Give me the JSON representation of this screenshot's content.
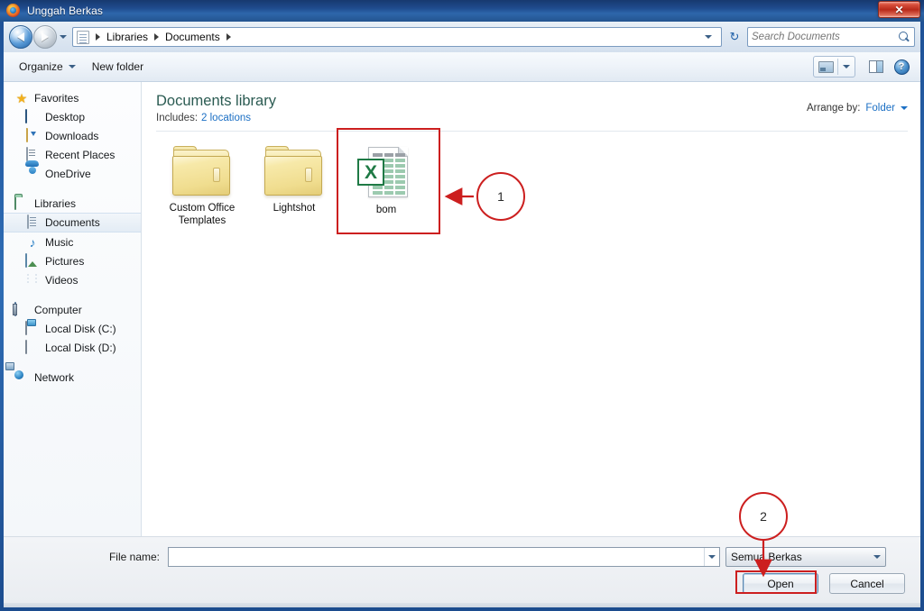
{
  "window": {
    "title": "Unggah Berkas",
    "title_icon": "firefox-icon",
    "close_label": "✕"
  },
  "address_bar": {
    "back_icon": "back-arrow-icon",
    "forward_icon": "forward-arrow-icon",
    "history_icon": "chevron-down-icon",
    "path_icon": "document-icon",
    "breadcrumbs": [
      "Libraries",
      "Documents"
    ],
    "dropdown_icon": "chevron-down-icon",
    "refresh_icon": "refresh-icon",
    "refresh_glyph": "↻"
  },
  "search": {
    "placeholder": "Search Documents",
    "value": "",
    "icon": "search-icon"
  },
  "toolbar": {
    "organize_label": "Organize",
    "organize_caret": "caret-down-icon",
    "new_folder_label": "New folder",
    "view_icon": "view-mode-icon",
    "view_caret": "chevron-down-icon",
    "preview_pane_icon": "preview-pane-icon",
    "help_icon": "help-icon",
    "help_glyph": "?"
  },
  "sidebar": {
    "groups": [
      {
        "header": {
          "label": "Favorites",
          "icon": "star-icon"
        },
        "items": [
          {
            "label": "Desktop",
            "icon": "desktop-icon"
          },
          {
            "label": "Downloads",
            "icon": "downloads-icon"
          },
          {
            "label": "Recent Places",
            "icon": "recent-places-icon"
          },
          {
            "label": "OneDrive",
            "icon": "onedrive-cloud-icon"
          }
        ]
      },
      {
        "header": {
          "label": "Libraries",
          "icon": "libraries-icon"
        },
        "items": [
          {
            "label": "Documents",
            "icon": "documents-icon",
            "selected": true
          },
          {
            "label": "Music",
            "icon": "music-note-icon"
          },
          {
            "label": "Pictures",
            "icon": "pictures-icon"
          },
          {
            "label": "Videos",
            "icon": "videos-icon"
          }
        ]
      },
      {
        "header": {
          "label": "Computer",
          "icon": "computer-icon"
        },
        "items": [
          {
            "label": "Local Disk (C:)",
            "icon": "system-drive-icon"
          },
          {
            "label": "Local Disk (D:)",
            "icon": "drive-icon"
          }
        ]
      },
      {
        "header": {
          "label": "Network",
          "icon": "network-icon"
        },
        "items": []
      }
    ]
  },
  "content": {
    "library_title": "Documents library",
    "includes_label": "Includes:",
    "locations_link": "2 locations",
    "arrange_label": "Arrange by:",
    "arrange_value": "Folder",
    "arrange_caret": "caret-down-icon",
    "files": [
      {
        "name": "Custom Office Templates",
        "type": "folder"
      },
      {
        "name": "Lightshot",
        "type": "folder"
      },
      {
        "name": "bom",
        "type": "excel-file",
        "highlighted": true
      }
    ]
  },
  "annotations": [
    {
      "id": "1",
      "label": "1",
      "target": "bom-file"
    },
    {
      "id": "2",
      "label": "2",
      "target": "open-button"
    }
  ],
  "footer": {
    "file_name_label": "File name:",
    "file_name_value": "",
    "file_name_placeholder": "",
    "file_name_caret": "caret-down-icon",
    "file_type_value": "Semua Berkas",
    "file_type_caret": "caret-down-icon",
    "open_label": "Open",
    "cancel_label": "Cancel"
  },
  "colors": {
    "annotation_red": "#cc1f1f",
    "library_title": "#2b5b52",
    "link_blue": "#1b6fc4",
    "titlebar_blue": "#1f4b8d",
    "excel_green": "#1f7a45"
  }
}
